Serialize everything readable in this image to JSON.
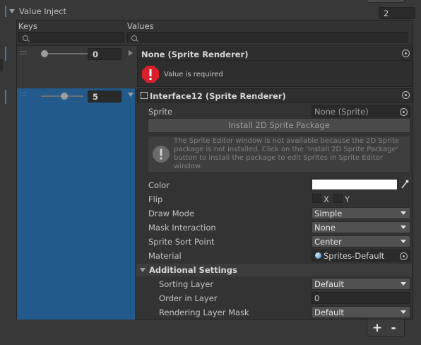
{
  "header": {
    "title": "Value Inject",
    "count": "2"
  },
  "columns": {
    "keys": "Keys",
    "values": "Values"
  },
  "rows": [
    {
      "key_value": "0",
      "object_label": "None (Sprite Renderer)",
      "error_message": "Value is required"
    },
    {
      "key_value": "5",
      "object_label": "Interface12 (Sprite Renderer)"
    }
  ],
  "sprite_renderer": {
    "sprite_label": "Sprite",
    "sprite_value": "None (Sprite)",
    "install_button": "Install 2D Sprite Package",
    "info_message": "The Sprite Editor window is not available because the 2D Sprite package is not installed. Click on the 'Install 2D Sprite Package' button to install the package to edit Sprites in Sprite Editor window.",
    "color_label": "Color",
    "color_value": "#ffffff",
    "flip_label": "Flip",
    "flip_x": "X",
    "flip_y": "Y",
    "draw_mode_label": "Draw Mode",
    "draw_mode_value": "Simple",
    "mask_label": "Mask Interaction",
    "mask_value": "None",
    "sort_point_label": "Sprite Sort Point",
    "sort_point_value": "Center",
    "material_label": "Material",
    "material_value": "Sprites-Default",
    "additional_settings": "Additional Settings",
    "sorting_layer_label": "Sorting Layer",
    "sorting_layer_value": "Default",
    "order_label": "Order in Layer",
    "order_value": "0",
    "rendering_mask_label": "Rendering Layer Mask",
    "rendering_mask_value": "Default"
  },
  "footer": {
    "add": "+",
    "remove": "-"
  },
  "icons": [
    "foldout-arrow-icon",
    "search-icon",
    "drag-handle-icon",
    "object-picker-icon",
    "error-icon",
    "info-icon",
    "eyedropper-icon",
    "material-sphere-icon",
    "dropdown-caret-icon",
    "sprite-renderer-icon"
  ],
  "colors": {
    "accent_blue": "#3a79bb",
    "selection_blue": "#235a8c",
    "error_red": "#d9202a",
    "panel": "#383838",
    "field": "#2a2a2a"
  }
}
